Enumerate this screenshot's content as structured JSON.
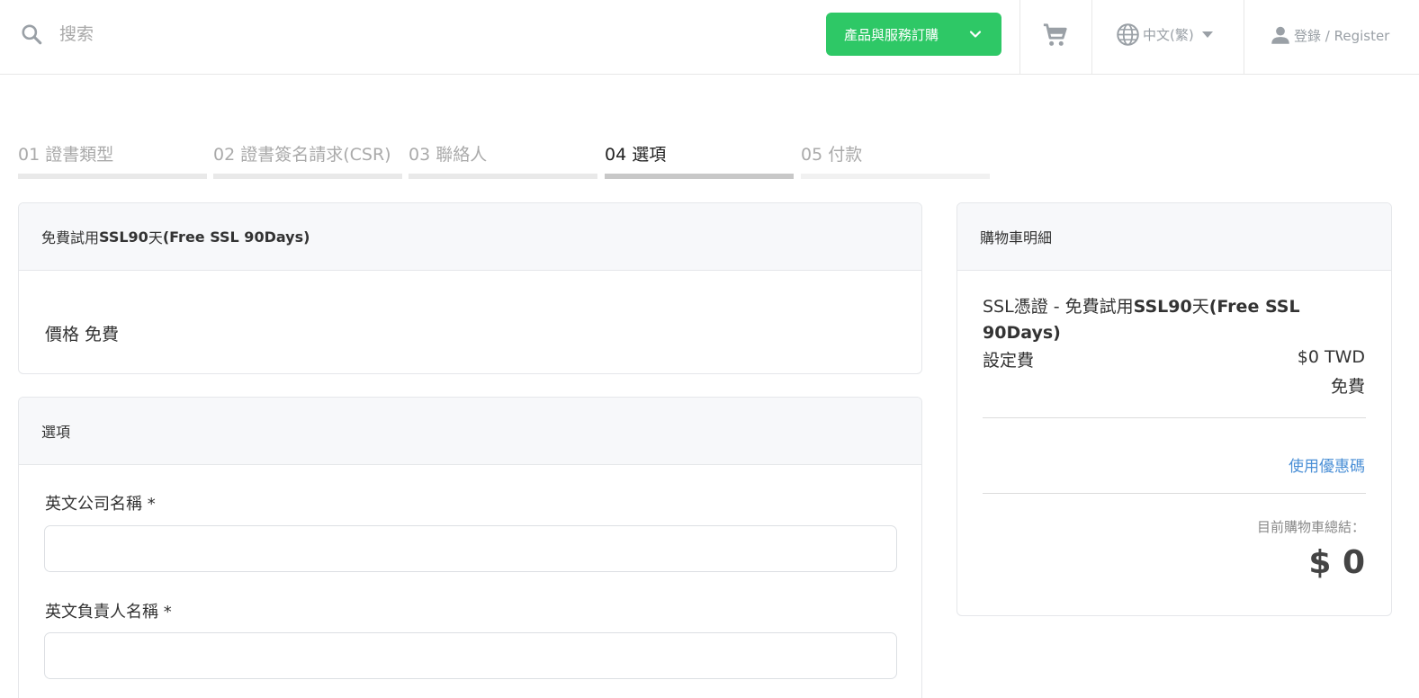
{
  "header": {
    "search_placeholder": "搜索",
    "order_button": "產品與服務訂購",
    "language": "中文(繁)",
    "login": "登錄 / Register"
  },
  "steps": [
    {
      "num": "01",
      "label": "證書類型"
    },
    {
      "num": "02",
      "label": "證書簽名請求(CSR)"
    },
    {
      "num": "03",
      "label": "聯絡人"
    },
    {
      "num": "04",
      "label": "選項"
    },
    {
      "num": "05",
      "label": "付款"
    }
  ],
  "product": {
    "title_prefix": "免費試用",
    "title_bold": "SSL90",
    "title_mid": "天",
    "title_bold2": "(Free SSL 90Days)",
    "price_label": "價格 免費"
  },
  "options": {
    "title": "選項",
    "fields": [
      {
        "label": "英文公司名稱 *",
        "value": ""
      },
      {
        "label": "英文負責人名稱 *",
        "value": ""
      }
    ]
  },
  "summary": {
    "title": "購物車明細",
    "item_prefix": "SSL憑證 - 免費試用",
    "item_bold": "SSL90",
    "item_mid": "天",
    "item_bold2": "(Free SSL 90Days)",
    "setup_label": "設定費",
    "setup_price": "$0 TWD",
    "setup_free": "免費",
    "promo_link": "使用優惠碼",
    "total_label": "目前購物車總結：",
    "total_value": "$ 0"
  },
  "colors": {
    "accent_green": "#2ec866",
    "link_blue": "#4a8fd6"
  }
}
